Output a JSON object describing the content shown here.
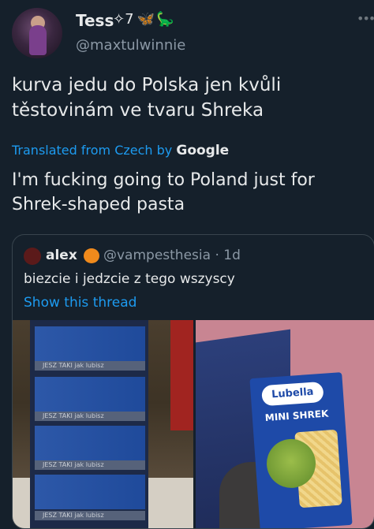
{
  "user": {
    "name": "Tess",
    "badges": [
      "✧",
      "7",
      "🦋",
      "🦕"
    ],
    "handle": "@maxtulwinnie"
  },
  "tweet": {
    "text": "kurva jedu do Polska jen kvůli těstovinám ve tvaru Shreka"
  },
  "translation": {
    "label": "Translated from Czech by",
    "provider": "Google",
    "text": "I'm fucking going to Poland just for Shrek-shaped pasta"
  },
  "quote": {
    "name": "alex",
    "handle": "@vampesthesia",
    "separator": "·",
    "time": "1d",
    "text": "biezcie i jedzcie z tego wszyscy",
    "show_thread": "Show this thread"
  },
  "photo1": {
    "shelf_sign": "JESZ TAKI jak lubisz"
  },
  "photo2": {
    "brand": "Lubella",
    "product": "MINI SHREK"
  },
  "colors": {
    "background": "#15202b",
    "link": "#1d9bf0",
    "secondary": "#8b98a5",
    "border": "#38444d"
  }
}
